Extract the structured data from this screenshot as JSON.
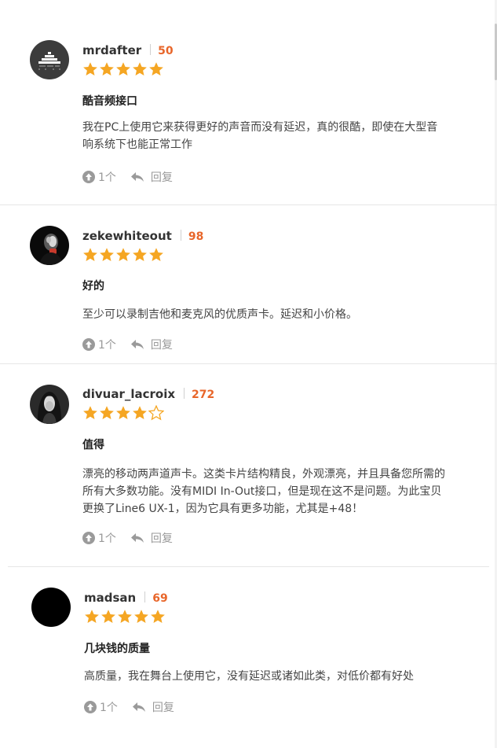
{
  "colors": {
    "star": "#f5a623",
    "star_empty_stroke": "#f5a623",
    "points": "#e8662a",
    "divider": "#e6e6e6",
    "muted": "#999999"
  },
  "reviews": [
    {
      "username": "mrdafter",
      "points": "50",
      "rating": 5,
      "title": "酷音频接口",
      "body_lines": [
        "我在PC上使用它来获得更好的声音而没有延迟，真的很酷，即使在大型音",
        "响系统下也能正常工作"
      ],
      "upvotes": "1个",
      "reply_label": "回复",
      "avatar_icon": "equalizer-avatar"
    },
    {
      "username": "zekewhiteout",
      "points": "98",
      "rating": 5,
      "title": "好的",
      "body_lines": [
        "至少可以录制吉他和麦克风的优质声卡。延迟和小价格。"
      ],
      "upvotes": "1个",
      "reply_label": "回复",
      "avatar_icon": "dark-photo-avatar"
    },
    {
      "username": "divuar_lacroix",
      "points": "272",
      "rating": 4,
      "title": "值得",
      "body_lines": [
        "漂亮的移动两声道声卡。这类卡片结构精良，外观漂亮，并且具备您所需的",
        "所有大多数功能。没有MIDI In-Out接口，但是现在这不是问题。为此宝贝",
        "更换了Line6 UX-1，因为它具有更多功能，尤其是+48！"
      ],
      "upvotes": "1个",
      "reply_label": "回复",
      "avatar_icon": "portrait-avatar"
    },
    {
      "username": "madsan",
      "points": "69",
      "rating": 5,
      "title": "几块钱的质量",
      "body_lines": [
        "高质量，我在舞台上使用它，没有延迟或诸如此类，对低价都有好处"
      ],
      "upvotes": "1个",
      "reply_label": "回复",
      "avatar_icon": "black-avatar"
    }
  ]
}
